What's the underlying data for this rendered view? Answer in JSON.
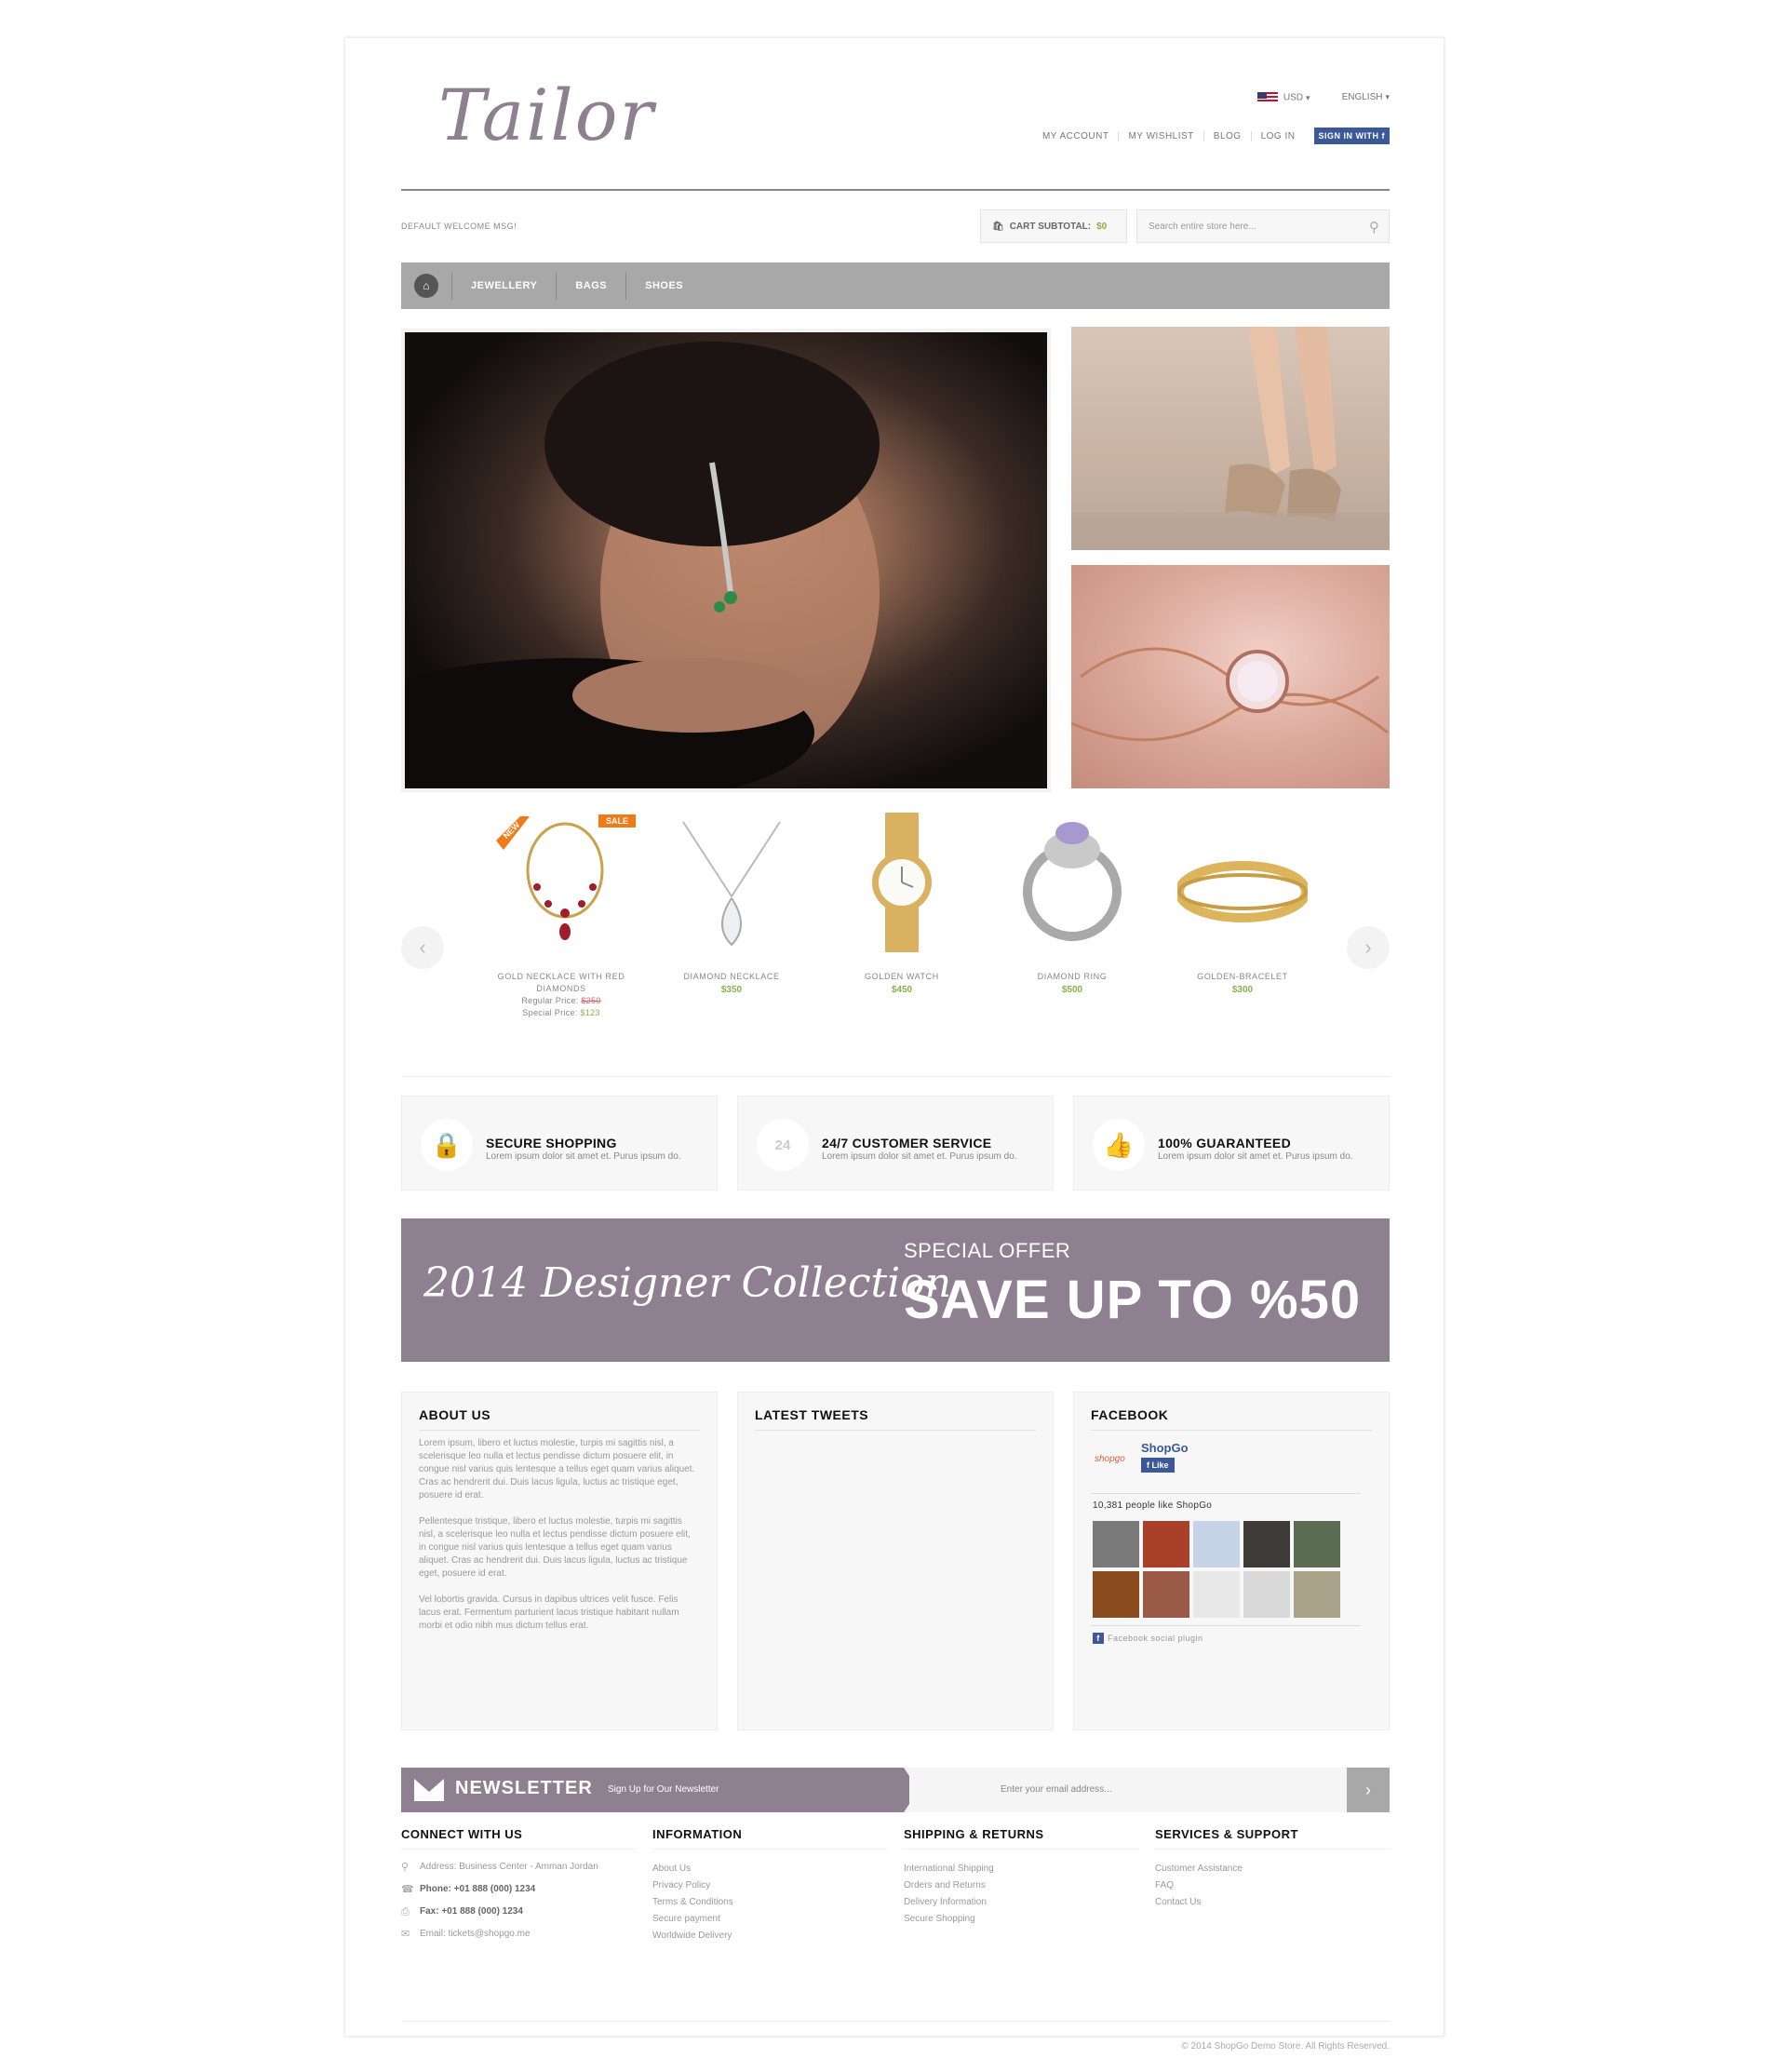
{
  "header": {
    "logo": "Tailor",
    "currency": "USD",
    "language": "ENGLISH",
    "links": [
      "MY ACCOUNT",
      "MY WISHLIST",
      "BLOG",
      "LOG IN"
    ],
    "fb_signin": "SIGN IN WITH f",
    "welcome": "DEFAULT WELCOME MSG!",
    "cart_label": "CART SUBTOTAL:",
    "cart_amount": "$0",
    "search_placeholder": "Search entire store here..."
  },
  "nav": {
    "items": [
      "JEWELLERY",
      "BAGS",
      "SHOES"
    ]
  },
  "products": [
    {
      "name": "GOLD NECKLACE WITH RED DIAMONDS",
      "regular_label": "Regular Price:",
      "regular": "$250",
      "special_label": "Special Price:",
      "special": "$123",
      "badge_new": "NEW",
      "badge_sale": "SALE"
    },
    {
      "name": "DIAMOND NECKLACE",
      "price": "$350"
    },
    {
      "name": "GOLDEN WATCH",
      "price": "$450"
    },
    {
      "name": "DIAMOND RING",
      "price": "$500"
    },
    {
      "name": "GOLDEN-BRACELET",
      "price": "$300"
    }
  ],
  "features": [
    {
      "title": "SECURE SHOPPING",
      "text": "Lorem ipsum dolor sit amet et. Purus ipsum do.",
      "icon": "lock-icon"
    },
    {
      "title": "24/7 CUSTOMER SERVICE",
      "text": "Lorem ipsum dolor sit amet et. Purus ipsum do.",
      "icon": "clock-24-icon"
    },
    {
      "title": "100% GUARANTEED",
      "text": "Lorem ipsum dolor sit amet et. Purus ipsum do.",
      "icon": "thumbs-up-icon"
    }
  ],
  "promo": {
    "script": "2014 Designer Collection",
    "special": "SPECIAL OFFER",
    "save": "SAVE UP TO %50",
    "color": "#8e7f91"
  },
  "about": {
    "title": "ABOUT US",
    "p1": "Lorem ipsum, libero et luctus molestie, turpis mi sagittis nisl, a scelerisque leo nulla et lectus pendisse dictum posuere elit, in congue nisl varius quis lentesque a tellus eget quam varius aliquet. Cras ac hendrerit dui. Duis lacus ligula, luctus ac tristique eget, posuere id erat.",
    "p2": "Pellentesque tristique, libero et luctus molestie, turpis mi sagittis nisl, a scelerisque leo nulla et lectus pendisse dictum posuere elit, in congue nisl varius quis lentesque a tellus eget quam varius aliquet. Cras ac hendrerit dui. Duis lacus ligula, luctus ac tristique eget, posuere id erat.",
    "p3": "Vel lobortis gravida. Cursus in dapibus ultrices velit fusce. Felis lacus erat. Fermentum parturient lacus tristique habitant nullam morbi et odio nibh mus dictum tellus erat."
  },
  "tweets": {
    "title": "LATEST TWEETS"
  },
  "facebook": {
    "title": "FACEBOOK",
    "page_name": "ShopGo",
    "logo": "shopgo",
    "like": "Like",
    "count": "10,381 people like ShopGo",
    "plugin": "Facebook social plugin"
  },
  "newsletter": {
    "title": "NEWSLETTER",
    "subtitle": "Sign Up for Our Newsletter",
    "placeholder": "Enter your email address..."
  },
  "footer": {
    "connect": {
      "title": "CONNECT WITH US",
      "address": "Address: Business Center - Amman Jordan",
      "phone_label": "Phone:",
      "phone": "+01 888 (000) 1234",
      "fax_label": "Fax:",
      "fax": "+01 888 (000) 1234",
      "email": "Email: tickets@shopgo.me"
    },
    "information": {
      "title": "INFORMATION",
      "items": [
        "About Us",
        "Privacy Policy",
        "Terms & Conditions",
        "Secure payment",
        "Worldwide Delivery"
      ]
    },
    "shipping": {
      "title": "SHIPPING & RETURNS",
      "items": [
        "International Shipping",
        "Orders and Returns",
        "Delivery Information",
        "Secure Shopping"
      ]
    },
    "services": {
      "title": "SERVICES & SUPPORT",
      "items": [
        "Customer Assistance",
        "FAQ",
        "Contact Us"
      ]
    },
    "copyright": "© 2014 ShopGo Demo Store. All Rights Reserved."
  }
}
